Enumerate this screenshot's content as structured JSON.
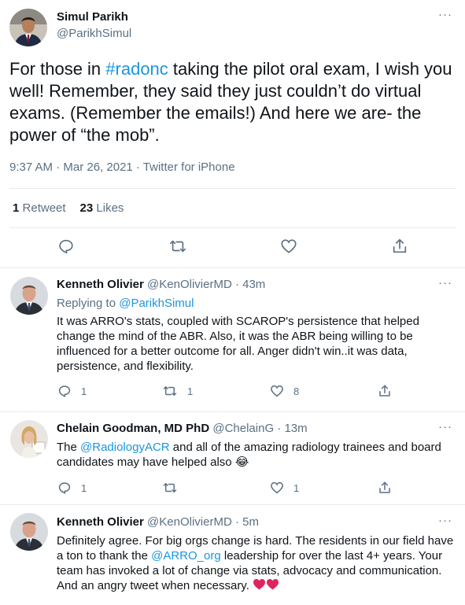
{
  "main_tweet": {
    "author_name": "Simul Parikh",
    "author_handle": "@ParikhSimul",
    "body_pre": "For those in ",
    "hashtag": "#radonc",
    "body_post": " taking the pilot oral exam, I wish you well! Remember, they said they just couldn’t do virtual exams. (Remember the emails!) And here we are- the power of “the mob”.",
    "meta": "9:37 AM · Mar 26, 2021 · Twitter for iPhone",
    "retweet_count": "1",
    "retweet_label": "Retweet",
    "like_count": "23",
    "like_label": "Likes",
    "more": "···"
  },
  "replies": [
    {
      "author_name": "Kenneth Olivier",
      "author_handle": "@KenOlivierMD",
      "time": "· 43m",
      "replying_label": "Replying to ",
      "replying_handle": "@ParikhSimul",
      "text": "It was ARRO's stats, coupled with SCAROP's persistence that helped change the mind of the ABR. Also, it was the ABR being willing to be influenced for a better outcome for all. Anger didn't win..it was data, persistence, and flexibility.",
      "reply_count": "1",
      "retweet_count": "1",
      "like_count": "8",
      "more": "···"
    },
    {
      "author_name": "Chelain Goodman, MD PhD",
      "author_handle": "@ChelainG",
      "time": "· 13m",
      "text_pre": "The ",
      "mention": "@RadiologyACR",
      "text_post": " and all of the amazing radiology trainees and board candidates may have helped also ",
      "emoji": "😂",
      "reply_count": "1",
      "retweet_count": "",
      "like_count": "1",
      "more": "···"
    },
    {
      "author_name": "Kenneth Olivier",
      "author_handle": "@KenOlivierMD",
      "time": "· 5m",
      "text_pre": "Definitely agree. For big orgs change is hard. The residents in our field have a ton to thank the ",
      "mention": "@ARRO_org",
      "text_post": " leadership for over the last 4+ years. Your team has invoked a lot of change via stats, advocacy and communication. And an angry tweet when necessary. ",
      "more": "···"
    }
  ],
  "colors": {
    "link": "#1b95e0",
    "secondary": "#5b7083",
    "divider": "#e6ecf0",
    "heart": "#e0245e"
  }
}
